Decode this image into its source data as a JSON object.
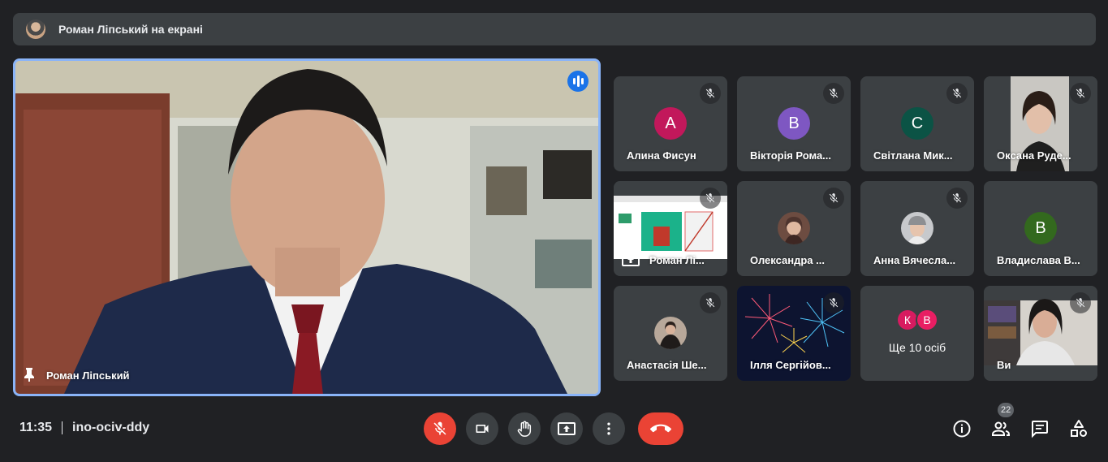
{
  "banner": {
    "text": "Роман Ліпський на екрані"
  },
  "main_tile": {
    "name": "Роман Ліпський",
    "speaking": true
  },
  "participants": [
    {
      "name": "Алина Фисун",
      "letter": "А",
      "color": "#c2185b",
      "muted": true,
      "type": "letter"
    },
    {
      "name": "Вікторія Рома...",
      "letter": "В",
      "color": "#7e57c2",
      "muted": true,
      "type": "letter"
    },
    {
      "name": "Світлана Мик...",
      "letter": "С",
      "color": "#0b5345",
      "muted": true,
      "type": "letter"
    },
    {
      "name": "Оксана Руде...",
      "muted": true,
      "type": "video"
    },
    {
      "name": "Роман Лі...",
      "muted": true,
      "type": "presentation"
    },
    {
      "name": "Олександра ...",
      "muted": true,
      "type": "photo"
    },
    {
      "name": "Анна Вячесла...",
      "muted": true,
      "type": "photo"
    },
    {
      "name": "Владислава В...",
      "letter": "В",
      "color": "#33691e",
      "muted": true,
      "type": "letter"
    },
    {
      "name": "Анастасія Ше...",
      "muted": true,
      "type": "photo"
    },
    {
      "name": "Ілля Сергійов...",
      "muted": true,
      "type": "fireworks"
    },
    {
      "name": "Ще 10 осіб",
      "letters": [
        "К",
        "В"
      ],
      "colors": [
        "#d81b60",
        "#e91e63"
      ],
      "type": "more"
    },
    {
      "name": "Ви",
      "muted": true,
      "type": "video"
    }
  ],
  "bottom_bar": {
    "time": "11:35",
    "meeting_code": "ino-ociv-ddy",
    "participants_count": "22"
  },
  "colors": {
    "accent": "#8ab4f8",
    "danger": "#ea4335",
    "surface": "#3c4043",
    "background": "#202124"
  }
}
